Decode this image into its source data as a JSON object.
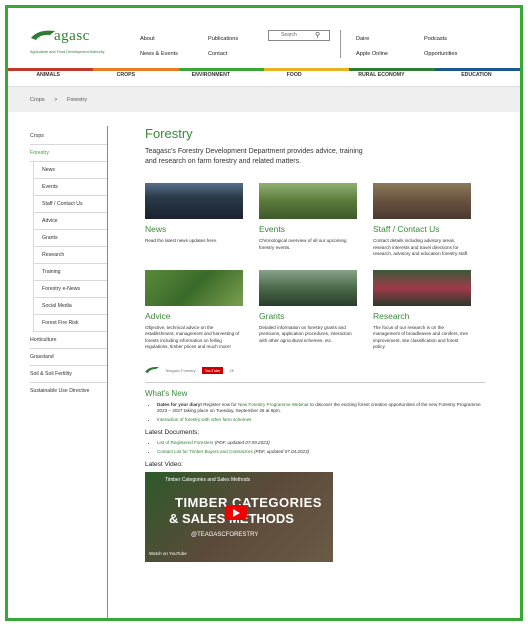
{
  "brand": {
    "logo_text": "agasc",
    "logo_sub": "Agriculture and Food Development Authority",
    "brand_green": "#3aa635"
  },
  "topnav": {
    "col1": [
      "About",
      "News & Events"
    ],
    "col2": [
      "Publications",
      "Contact"
    ],
    "search_placeholder": "Search",
    "col3": [
      "Daire",
      "Apple Online"
    ],
    "col4": [
      "Podcasts",
      "Opportunities"
    ]
  },
  "mainnav": {
    "items": [
      "Animals",
      "Crops",
      "Environment",
      "Food",
      "Rural Economy",
      "Education"
    ],
    "colors": [
      "#c0392b",
      "#e67e22",
      "#3aa635",
      "#e6b422",
      "#2f7d32",
      "#1a5a8a"
    ]
  },
  "breadcrumb": {
    "items": [
      "Crops",
      "Forestry"
    ],
    "sep": ">"
  },
  "sidebar": {
    "top": [
      "Crops",
      "Forestry"
    ],
    "sub": [
      "News",
      "Events",
      "Staff / Contact Us",
      "Advice",
      "Grants",
      "Research",
      "Training",
      "Forestry e-News",
      "Social Media",
      "Forest Fire Risk"
    ],
    "bottom": [
      "Horticulture",
      "Grassland",
      "Soil & Soil Fertility",
      "Sustainable Use Directive"
    ]
  },
  "page": {
    "title": "Forestry",
    "intro": "Teagasc's Forestry Development Department provides advice, training and research on farm forestry and related matters."
  },
  "cards_row1": [
    {
      "title": "News",
      "text": "Read the latest news updates here."
    },
    {
      "title": "Events",
      "text": "Chronological overview of all our upcoming forestry events."
    },
    {
      "title": "Staff / Contact Us",
      "text": "Contact details including advisory areas, research interests and travel directions for research, advisory and education forestry staff."
    }
  ],
  "cards_row2": [
    {
      "title": "Advice",
      "text": "Objective, technical advice on the establishment, management and harvesting of forests including information on felling regulations, timber prices and much more!"
    },
    {
      "title": "Grants",
      "text": "Detailed information on forestry grants and premiums, application procedures, interaction with other agricultural schemes, etc."
    },
    {
      "title": "Research",
      "text": "The focus of our research is on the management of broadleaves and conifers, tree improvement, site classification and forest policy."
    }
  ],
  "social": {
    "name": "Teagasc Forestry",
    "youtube": "YouTube",
    "count": "2K"
  },
  "whats_new": {
    "title": "What's New",
    "items": [
      {
        "bold": "Dates for your diary!",
        "text": " Register now for ",
        "link": "New Forestry Programme Webinar",
        "tail": " to discover the exciting forest creation opportunities of the new Forestry Programme 2023 – 2027 taking place on Tuesday, September 26 at 8pm."
      },
      {
        "bold": "",
        "text": "",
        "link": "Interaction of forestry with other farm schemes",
        "tail": ""
      }
    ]
  },
  "latest_docs": {
    "title": "Latest Documents:",
    "items": [
      {
        "link": "List of Registered Foresters",
        "note": " (PDF, updated 07.09.2023)"
      },
      {
        "link": "Contact List for Timber Buyers and Contractors",
        "note": " (PDF, updated 07.04.2023)"
      }
    ]
  },
  "latest_video": {
    "title": "Latest Video:",
    "video_title": "Timber Categories and Sales Methods",
    "big1": "TIMBER CATEGORIES",
    "big2": "& SALES METHODS",
    "sub": "@TEAGASCFORESTRY",
    "watch": "Watch on YouTube"
  }
}
